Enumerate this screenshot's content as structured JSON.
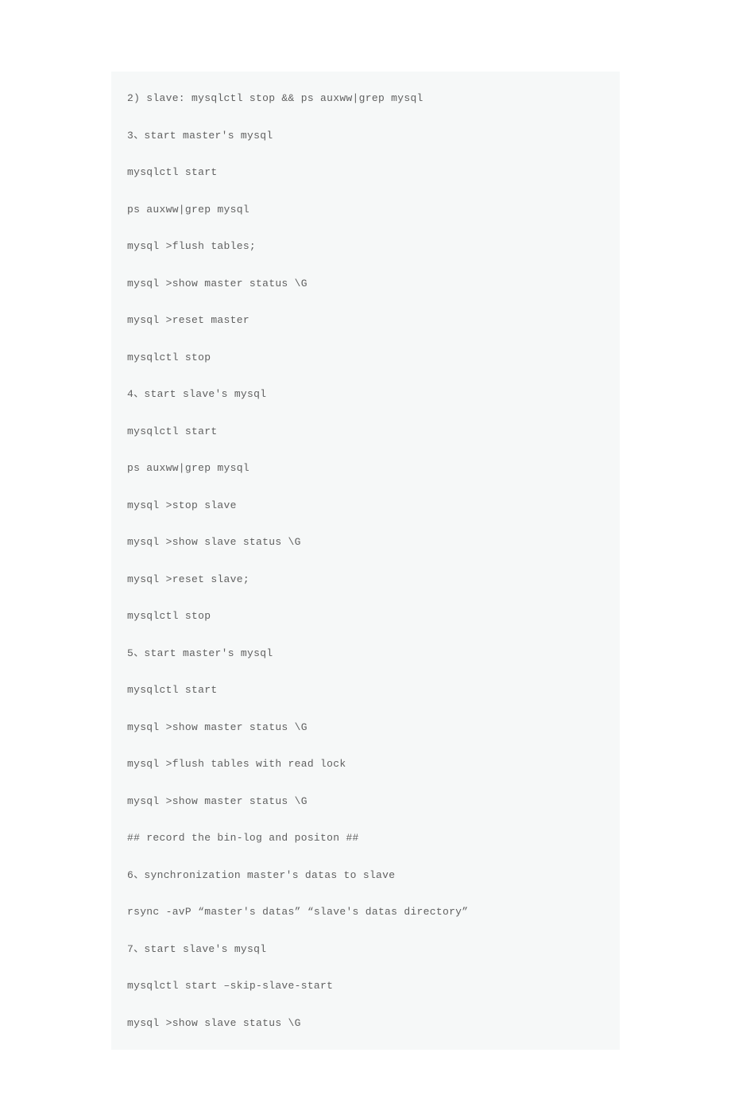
{
  "lines": [
    "2) slave: mysqlctl stop && ps auxww|grep mysql",
    "3、start master's mysql",
    "mysqlctl start",
    "ps auxww|grep mysql",
    "mysql >flush tables;",
    "mysql >show master status \\G",
    "mysql >reset master",
    "mysqlctl stop",
    "4、start slave's mysql",
    "mysqlctl start",
    "ps auxww|grep mysql",
    "mysql >stop slave",
    "mysql >show slave status \\G",
    "mysql >reset slave;",
    "mysqlctl stop",
    "5、start master's mysql",
    "mysqlctl start",
    "mysql >show master status \\G",
    "mysql >flush tables with read lock",
    "mysql >show master status \\G",
    "## record the bin-log and positon ##",
    "6、synchronization master's datas to slave",
    "rsync -avP “master's datas” “slave's datas directory”",
    "7、start slave's mysql",
    "mysqlctl start –skip-slave-start",
    "mysql >show slave status \\G"
  ]
}
